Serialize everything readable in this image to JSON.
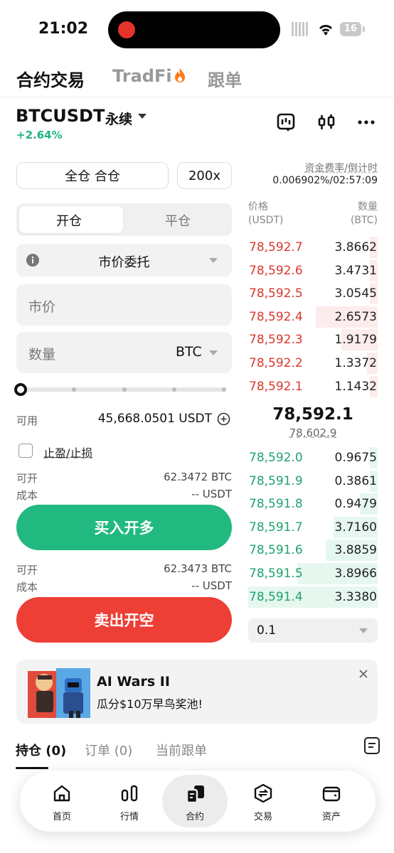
{
  "status_bar": {
    "time": "21:02",
    "battery": "16"
  },
  "top_tabs": [
    {
      "label": "合约交易",
      "active": true
    },
    {
      "label": "TradFi",
      "active": false
    },
    {
      "label": "跟单",
      "active": false
    }
  ],
  "instrument": {
    "symbol": "BTCUSDT",
    "type": "永续",
    "change": "+2.64%"
  },
  "funding": {
    "label": "资金费率/倒计时",
    "value": "0.006902%/02:57:09"
  },
  "order_form": {
    "margin_mode": "全仓 合仓",
    "leverage": "200x",
    "tabs": [
      {
        "label": "开仓",
        "active": true
      },
      {
        "label": "平仓",
        "active": false
      }
    ],
    "order_type": "市价委托",
    "price_placeholder": "市价",
    "qty_placeholder": "数量",
    "qty_unit": "BTC",
    "slider_percent": 0,
    "available_label": "可用",
    "available_value": "45,668.0501 USDT",
    "tpsl_label": "止盈/止损",
    "buy": {
      "open_label": "可开",
      "open_value": "62.3472 BTC",
      "cost_label": "成本",
      "cost_value": "-- USDT",
      "button": "买入开多"
    },
    "sell": {
      "open_label": "可开",
      "open_value": "62.3473 BTC",
      "cost_label": "成本",
      "cost_value": "-- USDT",
      "button": "卖出开空"
    }
  },
  "order_book": {
    "price_header": "价格",
    "price_unit": "(USDT)",
    "qty_header": "数量",
    "qty_unit": "(BTC)",
    "asks": [
      {
        "price": "78,592.7",
        "qty": "3.8662",
        "depth": 0.06
      },
      {
        "price": "78,592.6",
        "qty": "3.4731",
        "depth": 0.06
      },
      {
        "price": "78,592.5",
        "qty": "3.0545",
        "depth": 0.06
      },
      {
        "price": "78,592.4",
        "qty": "2.6573",
        "depth": 0.48
      },
      {
        "price": "78,592.3",
        "qty": "1.9179",
        "depth": 0.28
      },
      {
        "price": "78,592.2",
        "qty": "1.3372",
        "depth": 0.08
      },
      {
        "price": "78,592.1",
        "qty": "1.1432",
        "depth": 0.06
      }
    ],
    "last_price": "78,592.1",
    "mark_price": "78,602.9",
    "bids": [
      {
        "price": "78,592.0",
        "qty": "0.9675",
        "depth": 0.06
      },
      {
        "price": "78,591.9",
        "qty": "0.3861",
        "depth": 0.06
      },
      {
        "price": "78,591.8",
        "qty": "0.9479",
        "depth": 0.14
      },
      {
        "price": "78,591.7",
        "qty": "3.7160",
        "depth": 0.34
      },
      {
        "price": "78,591.6",
        "qty": "3.8859",
        "depth": 0.4
      },
      {
        "price": "78,591.5",
        "qty": "3.8966",
        "depth": 0.62
      },
      {
        "price": "78,591.4",
        "qty": "3.3380",
        "depth": 1.0
      }
    ],
    "precision": "0.1"
  },
  "banner": {
    "title": "AI Wars II",
    "subtitle": "瓜分$10万早鸟奖池!"
  },
  "bottom_tabs": [
    {
      "label": "持仓 (0)",
      "active": true
    },
    {
      "label": "订单 (0)",
      "active": false
    },
    {
      "label": "当前跟单",
      "active": false
    }
  ],
  "nav": [
    {
      "label": "首页",
      "icon": "home-icon"
    },
    {
      "label": "行情",
      "icon": "market-icon"
    },
    {
      "label": "合约",
      "icon": "futures-icon",
      "selected": true
    },
    {
      "label": "交易",
      "icon": "trade-icon"
    },
    {
      "label": "资产",
      "icon": "wallet-icon"
    }
  ],
  "colors": {
    "buy": "#21b97f",
    "sell": "#ee3f36",
    "ask_text": "#d9382e",
    "bid_text": "#1fa26e"
  }
}
